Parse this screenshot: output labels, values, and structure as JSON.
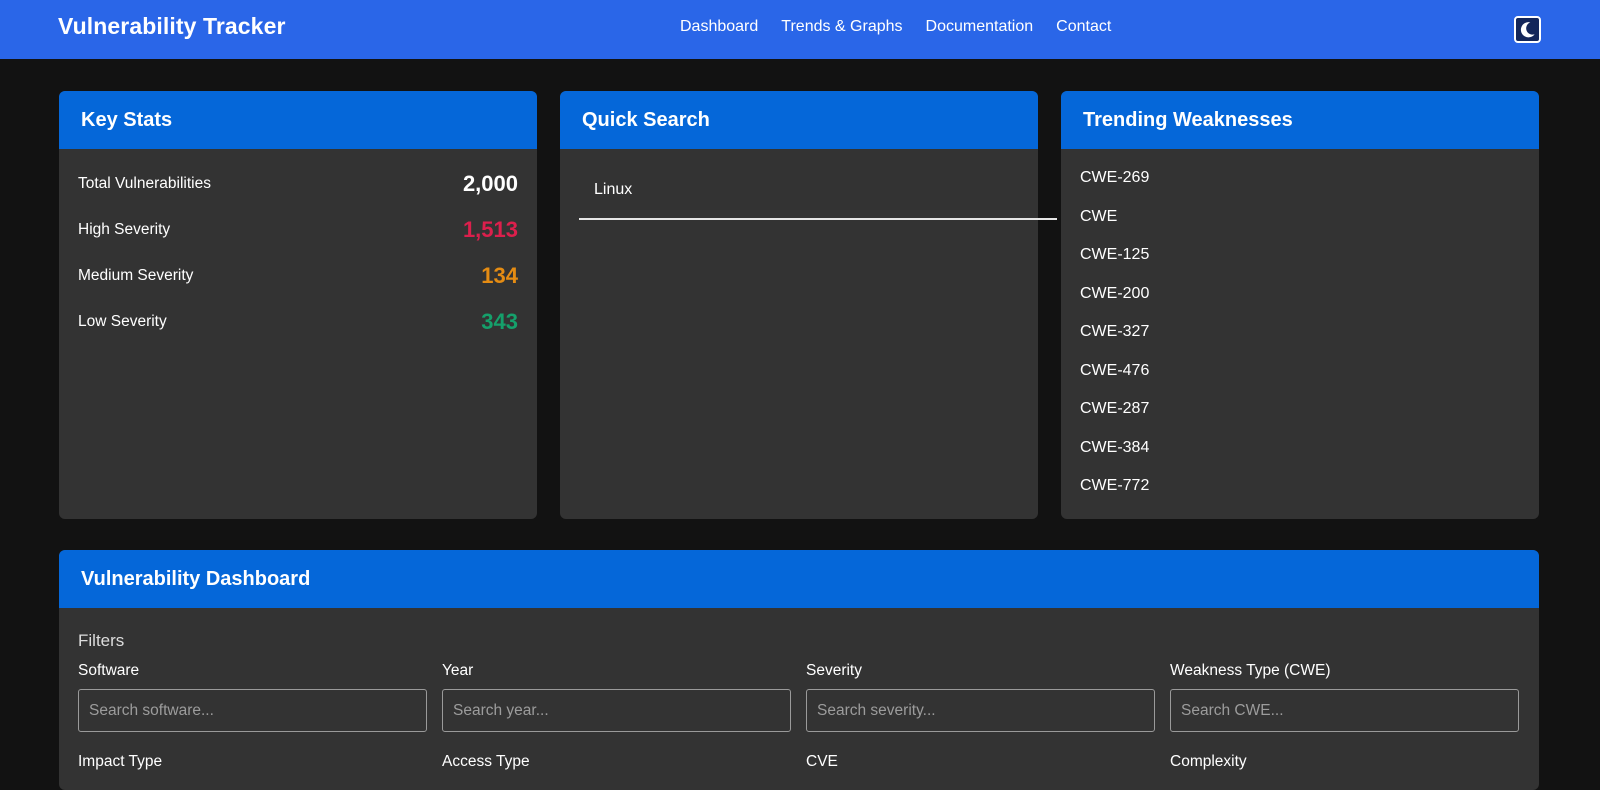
{
  "navbar": {
    "brand": "Vulnerability Tracker",
    "links": [
      "Dashboard",
      "Trends & Graphs",
      "Documentation",
      "Contact"
    ],
    "theme_toggle_icon": "moon-icon"
  },
  "key_stats": {
    "title": "Key Stats",
    "rows": [
      {
        "label": "Total Vulnerabilities",
        "value": "2,000",
        "color": "#ffffff"
      },
      {
        "label": "High Severity",
        "value": "1,513",
        "color": "#dc1f4c"
      },
      {
        "label": "Medium Severity",
        "value": "134",
        "color": "#e58c13"
      },
      {
        "label": "Low Severity",
        "value": "343",
        "color": "#15a06b"
      }
    ]
  },
  "quick_search": {
    "title": "Quick Search",
    "value": "Linux"
  },
  "trending": {
    "title": "Trending Weaknesses",
    "items": [
      "CWE-269",
      "CWE",
      "CWE-125",
      "CWE-200",
      "CWE-327",
      "CWE-476",
      "CWE-287",
      "CWE-384",
      "CWE-772"
    ]
  },
  "dashboard": {
    "title": "Vulnerability Dashboard",
    "filters_title": "Filters",
    "filters": [
      {
        "label": "Software",
        "placeholder": "Search software..."
      },
      {
        "label": "Year",
        "placeholder": "Search year..."
      },
      {
        "label": "Severity",
        "placeholder": "Search severity..."
      },
      {
        "label": "Weakness Type (CWE)",
        "placeholder": "Search CWE..."
      },
      {
        "label": "Impact Type",
        "placeholder": ""
      },
      {
        "label": "Access Type",
        "placeholder": ""
      },
      {
        "label": "CVE",
        "placeholder": ""
      },
      {
        "label": "Complexity",
        "placeholder": ""
      }
    ]
  },
  "colors": {
    "navbar": "#2a66e8",
    "card_header": "#0567d9",
    "card_body": "#333333",
    "page_bg": "#121212"
  }
}
